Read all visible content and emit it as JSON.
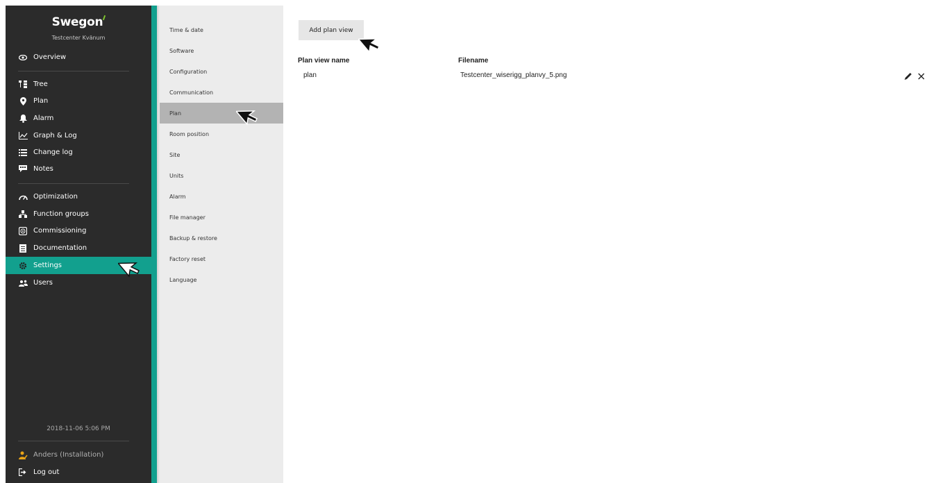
{
  "app": {
    "logo": "Swegon",
    "site_name": "Testcenter Kvänum",
    "accent_color": "#12a08e",
    "sidebar_bg": "#2b2b2b"
  },
  "sidebar": {
    "items": [
      {
        "label": "Overview",
        "icon": "eye-icon"
      },
      {
        "label": "Tree",
        "icon": "tree-icon"
      },
      {
        "label": "Plan",
        "icon": "map-pin-icon"
      },
      {
        "label": "Alarm",
        "icon": "bell-icon"
      },
      {
        "label": "Graph & Log",
        "icon": "graph-icon"
      },
      {
        "label": "Change log",
        "icon": "list-icon"
      },
      {
        "label": "Notes",
        "icon": "comment-icon"
      },
      {
        "label": "Optimization",
        "icon": "gauge-icon"
      },
      {
        "label": "Function groups",
        "icon": "hierarchy-icon"
      },
      {
        "label": "Commissioning",
        "icon": "fan-icon"
      },
      {
        "label": "Documentation",
        "icon": "document-icon"
      },
      {
        "label": "Settings",
        "icon": "gear-icon"
      },
      {
        "label": "Users",
        "icon": "users-icon"
      }
    ],
    "active": "Settings",
    "datetime": "2018-11-06 5:06 PM",
    "user": "Anders (Installation)",
    "logout": "Log out"
  },
  "settings_menu": {
    "items": [
      "Time & date",
      "Software",
      "Configuration",
      "Communication",
      "Plan",
      "Room position",
      "Site",
      "Units",
      "Alarm",
      "File manager",
      "Backup & restore",
      "Factory reset",
      "Language"
    ],
    "active": "Plan"
  },
  "main": {
    "add_button": "Add plan view",
    "columns": {
      "name": "Plan view name",
      "filename": "Filename"
    },
    "rows": [
      {
        "name": "plan",
        "filename": "Testcenter_wiserigg_planvy_5.png"
      }
    ]
  }
}
